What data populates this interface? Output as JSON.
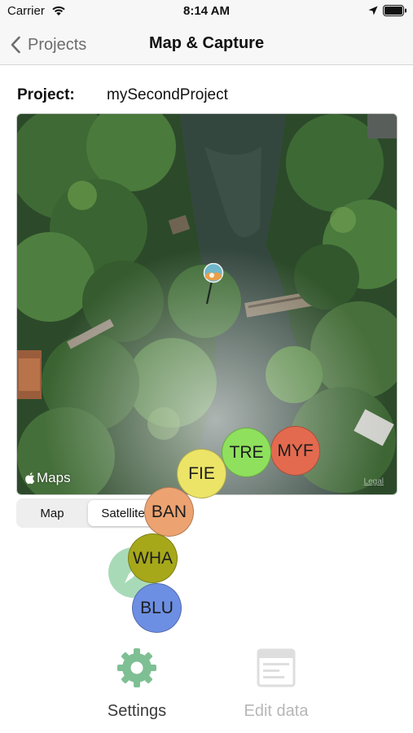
{
  "status_bar": {
    "carrier": "Carrier",
    "time": "8:14 AM"
  },
  "nav": {
    "back_label": "Projects",
    "title": "Map & Capture"
  },
  "project": {
    "label": "Project:",
    "name": "mySecondProject"
  },
  "map": {
    "attribution": "Maps",
    "legal": "Legal",
    "view_mode": "Satellite"
  },
  "segmented": {
    "map_label": "Map",
    "satellite_label": "Satellite"
  },
  "categories": [
    {
      "code": "MYF",
      "color": "#e36a4f"
    },
    {
      "code": "TRE",
      "color": "#8ee05d"
    },
    {
      "code": "FIE",
      "color": "#ece467"
    },
    {
      "code": "BAN",
      "color": "#eca371"
    },
    {
      "code": "WHA",
      "color": "#a6a81a"
    },
    {
      "code": "BLU",
      "color": "#6d8fe3"
    }
  ],
  "tabs": {
    "settings_label": "Settings",
    "edit_label": "Edit data"
  },
  "colors": {
    "accent": "#7fbf94",
    "disabled": "#b7b7b7",
    "fab": "#a9dab8"
  }
}
